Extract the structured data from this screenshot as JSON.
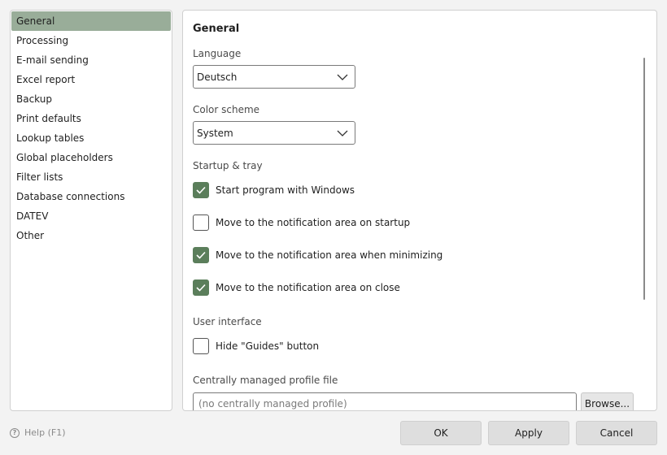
{
  "sidebar": {
    "items": [
      {
        "label": "General",
        "selected": true
      },
      {
        "label": "Processing"
      },
      {
        "label": "E-mail sending"
      },
      {
        "label": "Excel report"
      },
      {
        "label": "Backup"
      },
      {
        "label": "Print defaults"
      },
      {
        "label": "Lookup tables"
      },
      {
        "label": "Global placeholders"
      },
      {
        "label": "Filter lists"
      },
      {
        "label": "Database connections"
      },
      {
        "label": "DATEV"
      },
      {
        "label": "Other"
      }
    ]
  },
  "panel": {
    "title": "General",
    "language": {
      "label": "Language",
      "value": "Deutsch"
    },
    "color_scheme": {
      "label": "Color scheme",
      "value": "System"
    },
    "startup": {
      "label": "Startup & tray",
      "options": [
        {
          "label": "Start program with Windows",
          "checked": true
        },
        {
          "label": "Move to the notification area on startup",
          "checked": false
        },
        {
          "label": "Move to the notification area when minimizing",
          "checked": true
        },
        {
          "label": "Move to the notification area on close",
          "checked": true
        }
      ]
    },
    "ui": {
      "label": "User interface",
      "options": [
        {
          "label": "Hide \"Guides\" button",
          "checked": false
        }
      ]
    },
    "profile": {
      "label": "Centrally managed profile file",
      "placeholder": "(no centrally managed profile)",
      "browse_label": "Browse..."
    }
  },
  "footer": {
    "help_label": "Help (F1)",
    "ok_label": "OK",
    "apply_label": "Apply",
    "cancel_label": "Cancel"
  },
  "colors": {
    "accent": "#5b7e5b",
    "selected_bg": "#99ad99"
  }
}
